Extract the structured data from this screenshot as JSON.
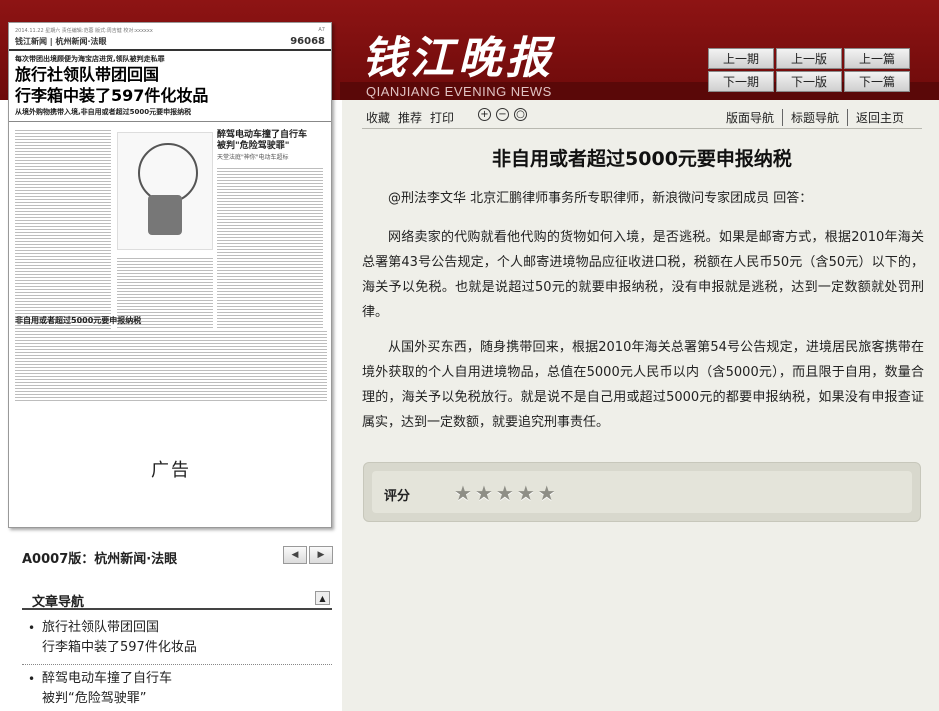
{
  "masthead": {
    "title_cn": "钱江晚报",
    "title_en": "QIANJIANG EVENING NEWS",
    "nav_buttons": [
      "上一期",
      "上一版",
      "上一篇",
      "下一期",
      "下一版",
      "下一篇"
    ]
  },
  "toolbar": {
    "left": [
      "收藏",
      "推荐",
      "打印"
    ],
    "zoom_in": "+",
    "zoom_out": "−",
    "zoom_reset": "○",
    "right": [
      "版面导航",
      "标题导航",
      "返回主页"
    ]
  },
  "paper_thumb": {
    "strip_left": "2014.11.22 星期六 责任编辑:范蓉 版式:周吉健 校对:xxxxxx",
    "strip_right": "A7",
    "section": "钱江新闻 | 杭州新闻·法眼",
    "number": "96068",
    "kicker": "每次带团出境顾便为海宝店进货,领队被判走私罪",
    "headline_1": "旅行社领队带团回国",
    "headline_2": "行李箱中装了597件化妆品",
    "subline": "从境外购物携带入境,非自用或者超过5000元要申报纳税",
    "side_head_1": "醉驾电动车撞了自行车",
    "side_head_2": "被判\"危险驾驶罪\"",
    "side_sub": "天堂法庭\"神你\"电动车超标",
    "sub_head": "非自用或者超过5000元要申报纳税",
    "ad": "广告"
  },
  "edition": {
    "label": "A0007版：杭州新闻·法眼",
    "prev": "◀",
    "next": "▶"
  },
  "article_nav": {
    "title": "文章导航",
    "collapse": "▲",
    "items": [
      {
        "line1": "旅行社领队带团回国",
        "line2": "行李箱中装了597件化妆品"
      },
      {
        "line1": "醉驾电动车撞了自行车",
        "line2": "被判“危险驾驶罪”"
      }
    ]
  },
  "article": {
    "title": "非自用或者超过5000元要申报纳税",
    "lead": "@刑法李文华 北京汇鹏律师事务所专职律师，新浪微问专家团成员 回答：",
    "para1": "网络卖家的代购就看他代购的货物如何入境，是否逃税。如果是邮寄方式，根据2010年海关总署第43号公告规定，个人邮寄进境物品应征收进口税，税额在人民币50元（含50元）以下的，海关予以免税。也就是说超过50元的就要申报纳税，没有申报就是逃税，达到一定数额就处罚刑律。",
    "para2": "从国外买东西，随身携带回来，根据2010年海关总署第54号公告规定，进境居民旅客携带在境外获取的个人自用进境物品，总值在5000元人民币以内（含5000元），而且限于自用，数量合理的，海关予以免税放行。就是说不是自己用或超过5000元的都要申报纳税，如果没有申报查证属实，达到一定数额，就要追究刑事责任。"
  },
  "rating": {
    "label": "评分",
    "star_glyph": "★",
    "stars": 5
  }
}
